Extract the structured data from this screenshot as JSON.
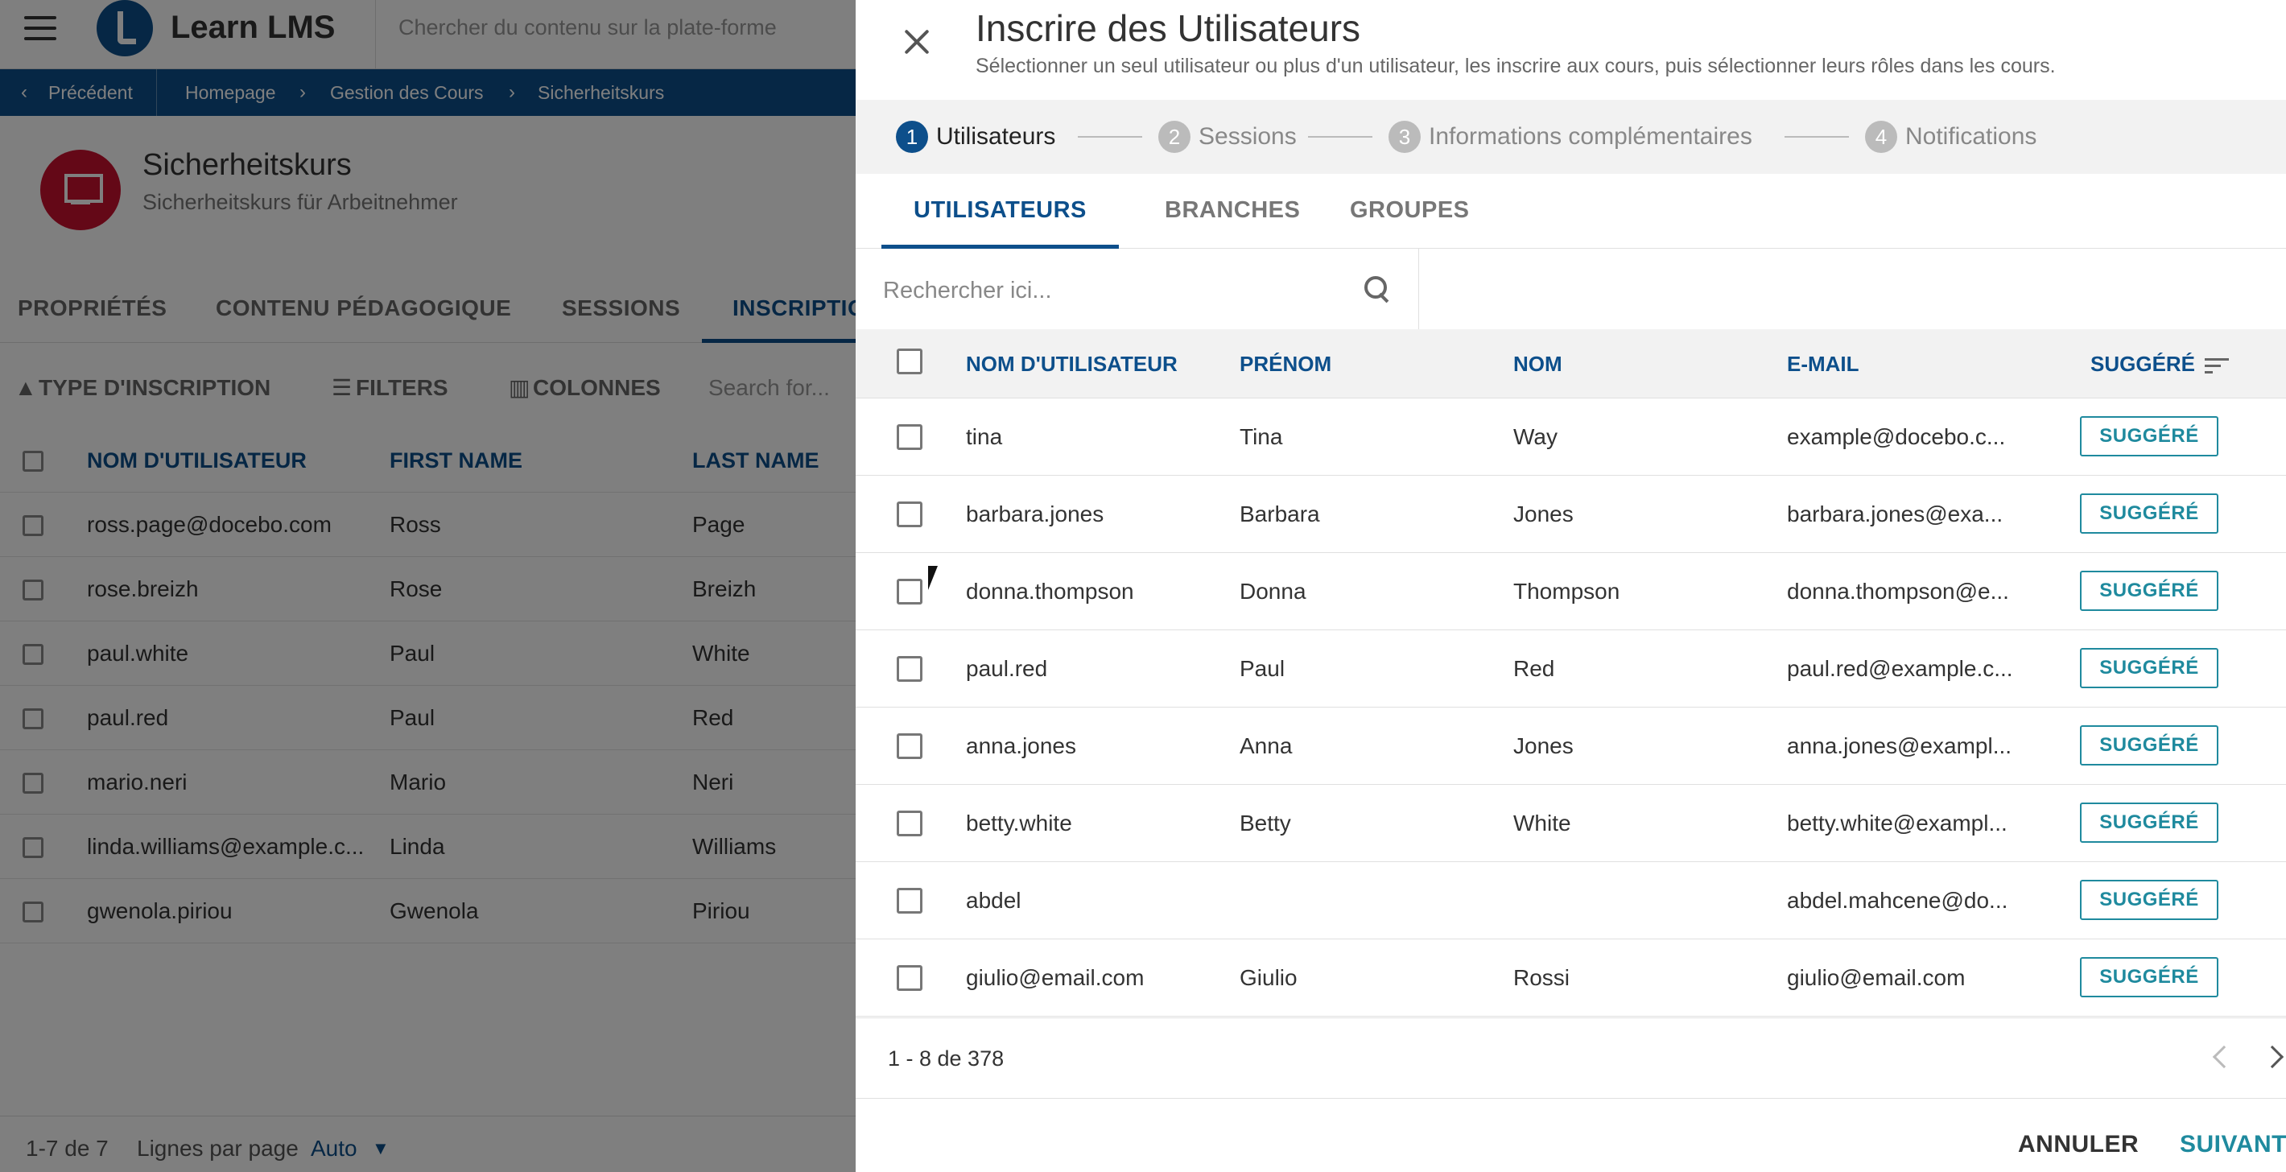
{
  "background": {
    "app": {
      "logo_text": "Learn LMS",
      "search_placeholder": "Chercher du contenu sur la plate-forme"
    },
    "breadcrumb": {
      "back": "Précédent",
      "items": [
        "Homepage",
        "Gestion des Cours",
        "Sicherheitskurs"
      ]
    },
    "course": {
      "title": "Sicherheitskurs",
      "subtitle": "Sicherheitskurs für Arbeitnehmer"
    },
    "tabs": [
      "PROPRIÉTÉS",
      "CONTENU PÉDAGOGIQUE",
      "SESSIONS",
      "INSCRIPTIO"
    ],
    "toolbar": {
      "type": "TYPE D'INSCRIPTION",
      "filters": "FILTERS",
      "columns": "COLONNES",
      "search_placeholder": "Search for..."
    },
    "table": {
      "headers": [
        "NOM D'UTILISATEUR",
        "FIRST NAME",
        "LAST NAME"
      ],
      "rows": [
        [
          "ross.page@docebo.com",
          "Ross",
          "Page"
        ],
        [
          "rose.breizh",
          "Rose",
          "Breizh"
        ],
        [
          "paul.white",
          "Paul",
          "White"
        ],
        [
          "paul.red",
          "Paul",
          "Red"
        ],
        [
          "mario.neri",
          "Mario",
          "Neri"
        ],
        [
          "linda.williams@example.c...",
          "Linda",
          "Williams"
        ],
        [
          "gwenola.piriou",
          "Gwenola",
          "Piriou"
        ]
      ]
    },
    "footer": {
      "range": "1-7 de 7",
      "rows_per_page_label": "Lignes par page",
      "rows_per_page_value": "Auto"
    }
  },
  "dialog": {
    "title": "Inscrire des Utilisateurs",
    "subtitle": "Sélectionner un seul utilisateur ou plus d'un utilisateur, les inscrire aux cours, puis sélectionner leurs rôles dans les cours.",
    "steps": [
      {
        "num": "1",
        "label": "Utilisateurs"
      },
      {
        "num": "2",
        "label": "Sessions"
      },
      {
        "num": "3",
        "label": "Informations complémentaires"
      },
      {
        "num": "4",
        "label": "Notifications"
      }
    ],
    "tabs": [
      "UTILISATEURS",
      "BRANCHES",
      "GROUPES"
    ],
    "search_placeholder": "Rechercher ici...",
    "table": {
      "headers": [
        "NOM D'UTILISATEUR",
        "PRÉNOM",
        "NOM",
        "E-MAIL",
        "SUGGÉRÉ"
      ],
      "suggest_label": "SUGGÉRÉ",
      "rows": [
        [
          "tina",
          "Tina",
          "Way",
          "example@docebo.c..."
        ],
        [
          "barbara.jones",
          "Barbara",
          "Jones",
          "barbara.jones@exa..."
        ],
        [
          "donna.thompson",
          "Donna",
          "Thompson",
          "donna.thompson@e..."
        ],
        [
          "paul.red",
          "Paul",
          "Red",
          "paul.red@example.c..."
        ],
        [
          "anna.jones",
          "Anna",
          "Jones",
          "anna.jones@exampl..."
        ],
        [
          "betty.white",
          "Betty",
          "White",
          "betty.white@exampl..."
        ],
        [
          "abdel",
          "",
          "",
          "abdel.mahcene@do..."
        ],
        [
          "giulio@email.com",
          "Giulio",
          "Rossi",
          "giulio@email.com"
        ]
      ]
    },
    "pager": {
      "info": "1 - 8 de 378"
    },
    "actions": {
      "cancel": "ANNULER",
      "next": "SUIVANT"
    }
  },
  "colors": {
    "brand": "#0d4f8b",
    "accent": "#1f8a9e",
    "course_icon": "#c8102e"
  }
}
